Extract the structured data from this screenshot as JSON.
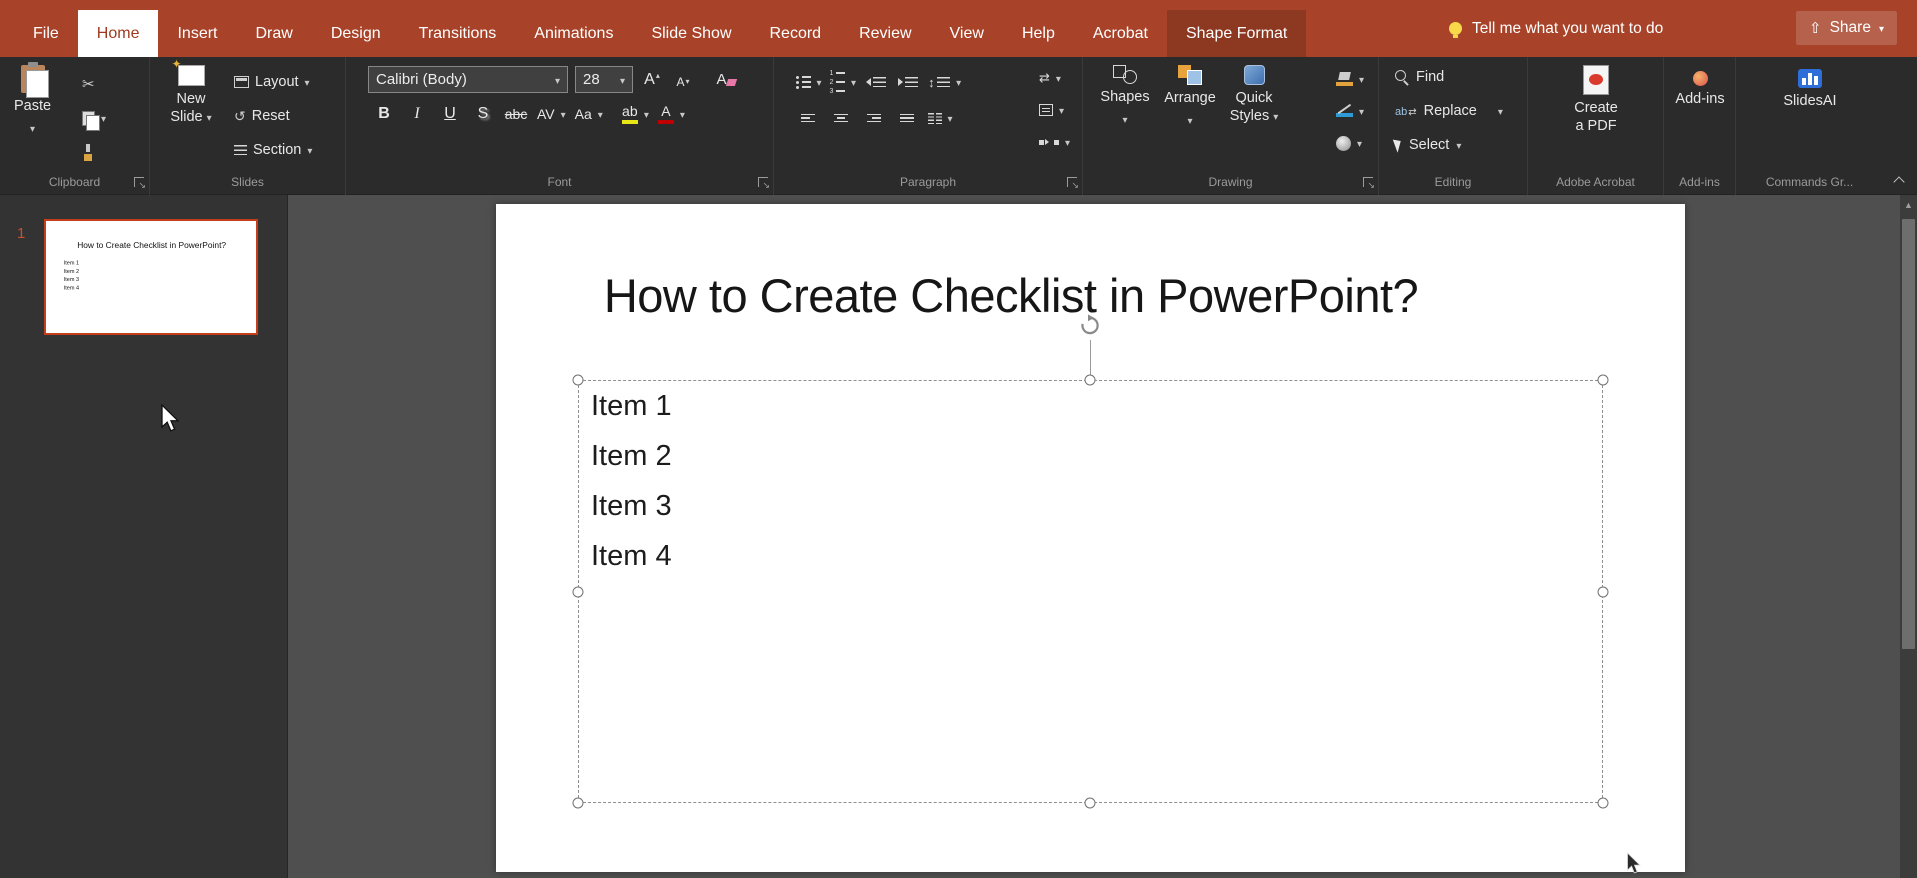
{
  "titlebar": {
    "tabs": [
      {
        "label": "File"
      },
      {
        "label": "Home"
      },
      {
        "label": "Insert"
      },
      {
        "label": "Draw"
      },
      {
        "label": "Design"
      },
      {
        "label": "Transitions"
      },
      {
        "label": "Animations"
      },
      {
        "label": "Slide Show"
      },
      {
        "label": "Record"
      },
      {
        "label": "Review"
      },
      {
        "label": "View"
      },
      {
        "label": "Help"
      },
      {
        "label": "Acrobat"
      },
      {
        "label": "Shape Format"
      }
    ],
    "tell_me": "Tell me what you want to do",
    "share": "Share"
  },
  "ribbon": {
    "clipboard": {
      "label": "Clipboard",
      "paste": "Paste"
    },
    "slides": {
      "label": "Slides",
      "new_slide": "New Slide",
      "layout": "Layout",
      "reset": "Reset",
      "section": "Section"
    },
    "font": {
      "label": "Font",
      "font_name": "Calibri (Body)",
      "font_size": "28",
      "bold": "B",
      "italic": "I",
      "underline": "U",
      "shadow": "S",
      "strikethrough": "abc",
      "char_spacing": "AV",
      "change_case": "Aa",
      "highlight": "ab",
      "font_color": "A"
    },
    "paragraph": {
      "label": "Paragraph"
    },
    "drawing": {
      "label": "Drawing",
      "shapes": "Shapes",
      "arrange": "Arrange",
      "quick_styles": "Quick Styles"
    },
    "editing": {
      "label": "Editing",
      "find": "Find",
      "replace": "Replace",
      "select": "Select"
    },
    "adobe_acrobat": {
      "label": "Adobe Acrobat",
      "create_pdf": "Create a PDF"
    },
    "addins": {
      "label": "Add-ins",
      "button": "Add-ins"
    },
    "commands": {
      "label": "Commands Gr...",
      "slidesai": "SlidesAI"
    }
  },
  "slide_panel": {
    "slide_number": "1"
  },
  "slide": {
    "title": "How to Create Checklist in PowerPoint?",
    "items": [
      "Item 1",
      "Item 2",
      "Item 3",
      "Item 4"
    ]
  },
  "colors": {
    "titlebar": "#a8432a",
    "contextual_tab": "#8d3820",
    "ribbon": "#2b2b2b",
    "panel": "#333333",
    "canvas": "#4f4f4f",
    "selection_border": "#c43e1c"
  }
}
